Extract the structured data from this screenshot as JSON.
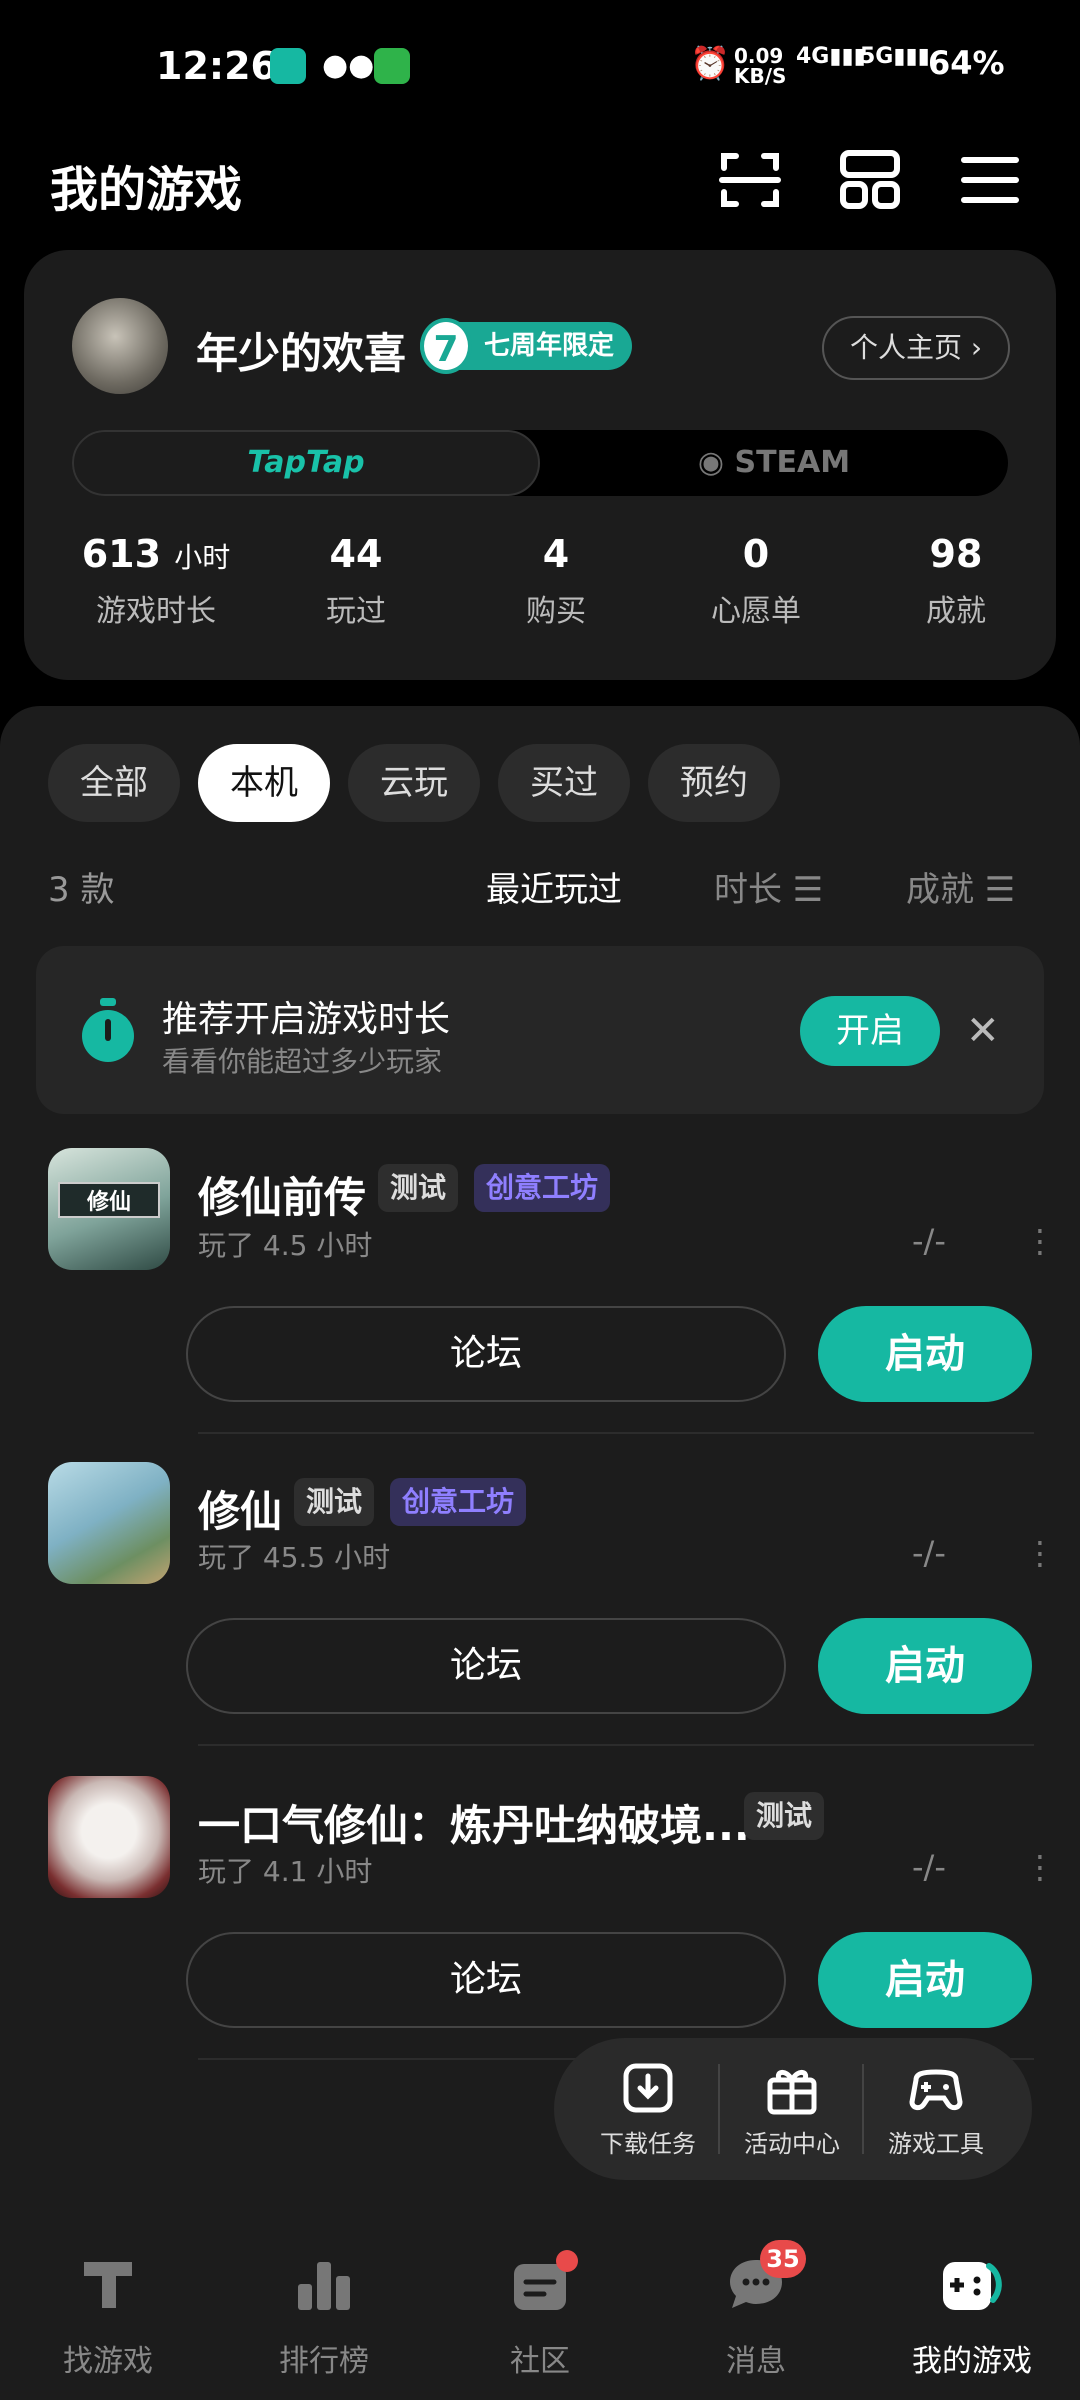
{
  "status_bar": {
    "time": "12:26",
    "speed": "0.09 KB/S",
    "net1": "4G",
    "net2": "5G",
    "battery": "64%"
  },
  "header": {
    "title": "我的游戏"
  },
  "profile": {
    "username": "年少的欢喜",
    "badge_number": "7",
    "badge": "七周年限定",
    "homepage_button": "个人主页 ›",
    "platform_tabs": [
      "TapTap",
      "STEAM"
    ],
    "stats": [
      {
        "value": "613",
        "unit": "小时",
        "label": "游戏时长"
      },
      {
        "value": "44",
        "unit": "",
        "label": "玩过"
      },
      {
        "value": "4",
        "unit": "",
        "label": "购买"
      },
      {
        "value": "0",
        "unit": "",
        "label": "心愿单"
      },
      {
        "value": "98",
        "unit": "",
        "label": "成就"
      }
    ]
  },
  "filters": {
    "chips": [
      "全部",
      "本机",
      "云玩",
      "买过",
      "预约"
    ],
    "selected": "本机"
  },
  "list_bar": {
    "count": "3 款",
    "sort": [
      "最近玩过",
      "时长 ☰",
      "成就 ☰"
    ]
  },
  "promo": {
    "title": "推荐开启游戏时长",
    "subtitle": "看看你能超过多少玩家",
    "button": "开启",
    "close": "✕"
  },
  "games": [
    {
      "name": "修仙前传",
      "tags": [
        "测试",
        "创意工坊"
      ],
      "played": "玩了 4.5 小时",
      "rating": "-/-",
      "forum": "论坛",
      "launch": "启动",
      "icon_text": "修仙"
    },
    {
      "name": "修仙",
      "tags": [
        "测试",
        "创意工坊"
      ],
      "played": "玩了 45.5 小时",
      "rating": "-/-",
      "forum": "论坛",
      "launch": "启动",
      "icon_text": ""
    },
    {
      "name": "一口气修仙：炼丹吐纳破境...",
      "tags": [
        "测试"
      ],
      "played": "玩了 4.1 小时",
      "rating": "-/-",
      "forum": "论坛",
      "launch": "启动",
      "icon_text": ""
    }
  ],
  "float_tools": [
    "下载任务",
    "活动中心",
    "游戏工具"
  ],
  "bottom_nav": {
    "items": [
      "找游戏",
      "排行榜",
      "社区",
      "消息",
      "我的游戏"
    ],
    "selected": "我的游戏",
    "message_badge": "35"
  },
  "colors": {
    "accent": "#16b8a2",
    "background": "#000000",
    "card": "#1c1c1c",
    "purple_tag": "#8f7fff"
  }
}
